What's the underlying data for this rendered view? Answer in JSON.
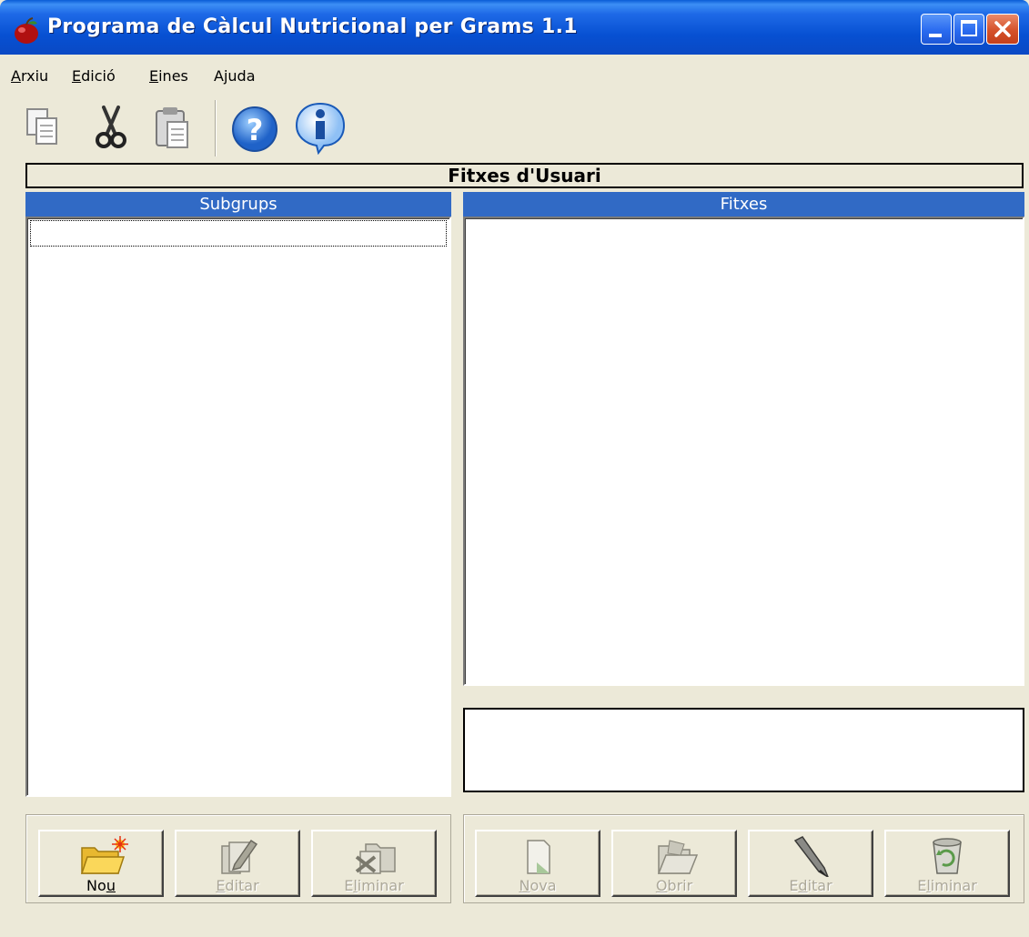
{
  "window": {
    "title": "Programa de Càlcul Nutricional per Grams 1.1"
  },
  "menu": [
    {
      "pre": "",
      "key": "A",
      "post": "rxiu"
    },
    {
      "pre": "",
      "key": "E",
      "post": "dició"
    },
    {
      "pre": "",
      "key": "E",
      "post": "ines"
    },
    {
      "pre": "A",
      "key": "j",
      "post": "uda"
    }
  ],
  "toolbar": {
    "icons": [
      "copy-icon",
      "cut-icon",
      "paste-icon",
      "help-icon",
      "info-icon"
    ]
  },
  "panel": {
    "header": "Fitxes d'Usuari",
    "subgroups_title": "Subgrups",
    "files_title": "Fitxes"
  },
  "subgroup_buttons": [
    {
      "pre": "No",
      "key": "u",
      "post": "",
      "enabled": true
    },
    {
      "pre": "",
      "key": "E",
      "post": "ditar",
      "enabled": false
    },
    {
      "pre": "E",
      "key": "l",
      "post": "iminar",
      "enabled": false
    }
  ],
  "file_buttons": [
    {
      "pre": "",
      "key": "N",
      "post": "ova",
      "enabled": false
    },
    {
      "pre": "",
      "key": "O",
      "post": "brir",
      "enabled": false
    },
    {
      "pre": "E",
      "key": "d",
      "post": "itar",
      "enabled": false
    },
    {
      "pre": "E",
      "key": "l",
      "post": "iminar",
      "enabled": false
    }
  ],
  "colors": {
    "titlebar": "#0a5cd6",
    "column_header": "#316ac5",
    "window_bg": "#ece9d8",
    "disabled_text": "#aca899"
  }
}
